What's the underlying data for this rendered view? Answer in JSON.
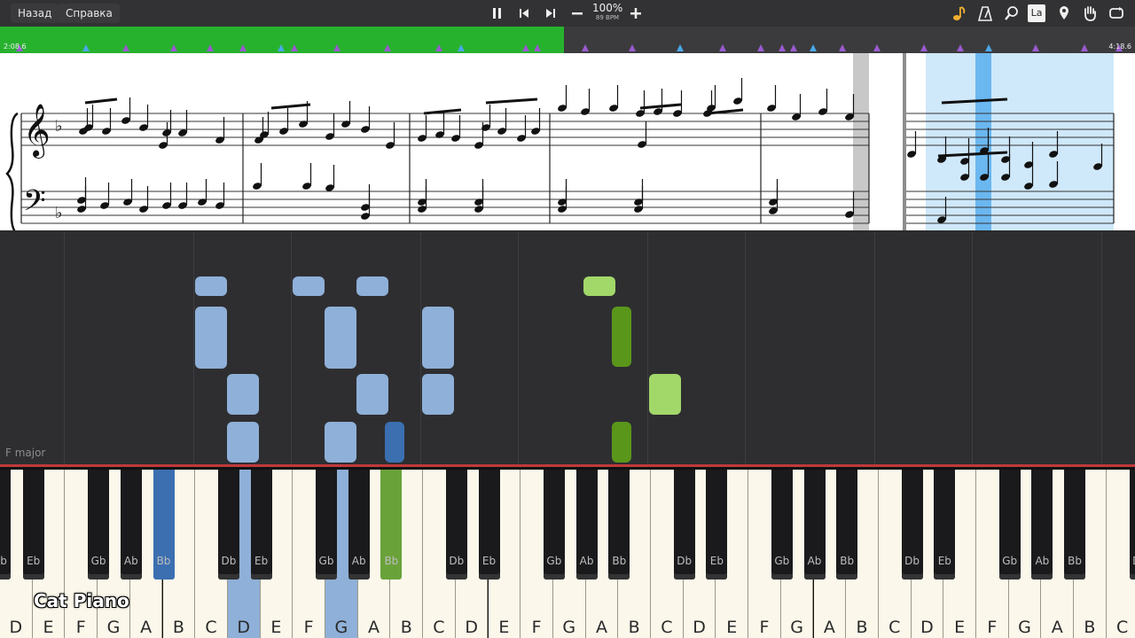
{
  "topbar": {
    "back_label": "Назад",
    "help_label": "Справка",
    "tempo_percent": "100%",
    "tempo_bpm": "89 BPM",
    "icons": [
      "pause-icon",
      "skip-back-icon",
      "skip-forward-icon",
      "minus-icon",
      "plus-icon",
      "note-icon",
      "metronome-icon",
      "magnifier-icon",
      "label-icon",
      "marker-icon",
      "hand-icon",
      "loop-icon"
    ],
    "label_button": "La"
  },
  "timeline": {
    "elapsed": "2:08.6",
    "total": "4:18.6",
    "progress": 0.497,
    "progress_color": "#27b22e"
  },
  "roll": {
    "key_signature": "F major"
  },
  "keyboard": {
    "white_keys": [
      "D",
      "E",
      "F",
      "G",
      "A",
      "B",
      "C",
      "D",
      "E",
      "F",
      "G",
      "A",
      "B",
      "C",
      "D",
      "E",
      "F",
      "G",
      "A",
      "B",
      "C",
      "D",
      "E",
      "F",
      "G",
      "A",
      "B",
      "C",
      "D",
      "E",
      "F",
      "G",
      "A",
      "B",
      "C"
    ],
    "black_keys": [
      "Bb",
      "Eb",
      "Gb",
      "Ab",
      "Bb",
      "Db",
      "Eb",
      "Gb",
      "Ab",
      "Bb",
      "Db",
      "Eb",
      "Gb",
      "Ab",
      "Bb",
      "Db",
      "Eb",
      "Gb",
      "Ab",
      "Bb",
      "Db",
      "Eb",
      "Gb",
      "Ab",
      "Bb",
      "Db"
    ],
    "highlight_colors": {
      "light_blue": "#8fb0d8",
      "dark_blue": "#3b6fb0",
      "green": "#6aa23a"
    }
  },
  "watermark": "Cat Piano"
}
